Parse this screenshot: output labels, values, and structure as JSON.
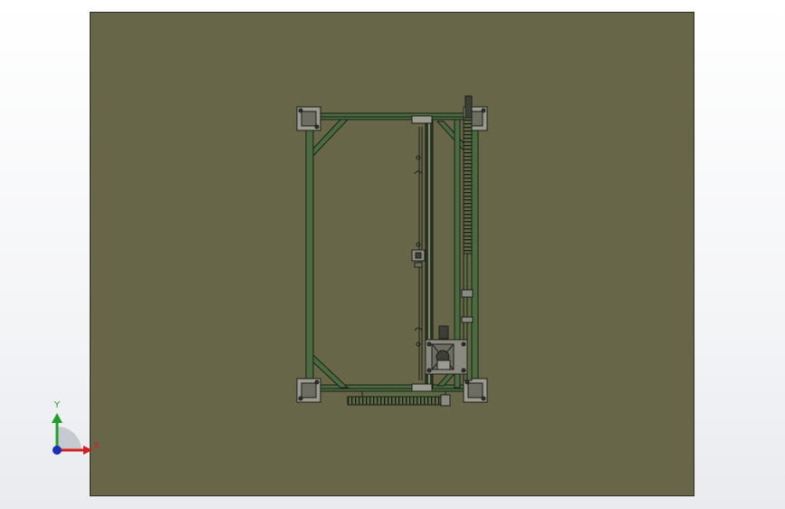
{
  "viewport": {
    "background_color": "#f4f5f7",
    "plate_color": "#676649",
    "frame_color": "#4a6a3f",
    "line_color": "#1c1f18"
  },
  "triad": {
    "x_label": "X",
    "y_label": "Y",
    "x_color": "#d21f1f",
    "y_color": "#1fa02a",
    "z_color": "#1d2fb5"
  }
}
